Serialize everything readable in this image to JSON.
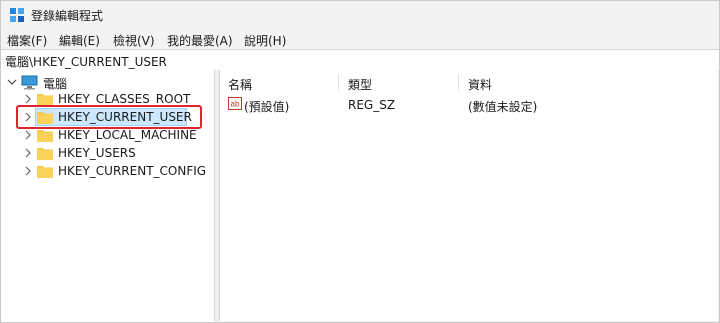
{
  "window": {
    "title": "登錄編輯程式",
    "icon": "regedit-icon"
  },
  "menu": [
    "檔案(F)",
    "編輯(E)",
    "檢視(V)",
    "我的最愛(A)",
    "說明(H)"
  ],
  "address": "電腦\\HKEY_CURRENT_USER",
  "tree": {
    "root": "電腦",
    "items": [
      {
        "label": "HKEY_CLASSES_ROOT",
        "selected": false
      },
      {
        "label": "HKEY_CURRENT_USER",
        "selected": true
      },
      {
        "label": "HKEY_LOCAL_MACHINE",
        "selected": false
      },
      {
        "label": "HKEY_USERS",
        "selected": false
      },
      {
        "label": "HKEY_CURRENT_CONFIG",
        "selected": false
      }
    ]
  },
  "list": {
    "columns": [
      "名稱",
      "類型",
      "資料"
    ],
    "rows": [
      {
        "name": "(預設值)",
        "type": "REG_SZ",
        "data": "(數值未設定)",
        "icon": "string-value-icon"
      }
    ]
  },
  "colors": {
    "selection": "#cce8ff",
    "highlight": "#e0242b",
    "folder": "#f7c948"
  }
}
